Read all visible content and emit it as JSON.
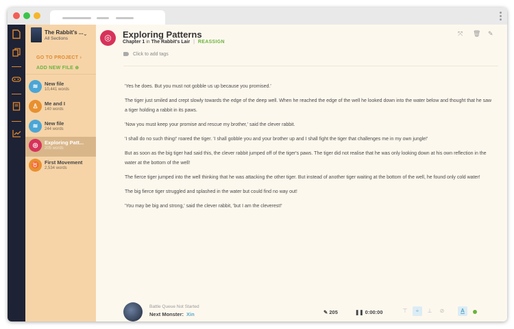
{
  "colors": {
    "accent_orange": "#e0892e",
    "accent_green": "#6bb33d",
    "rail_bg": "#1e2235",
    "sidebar_bg": "#f6d4a8",
    "active_red": "#d7325a",
    "blue": "#5aa8c8"
  },
  "rail": {
    "icons": [
      "document-icon",
      "copy-icon",
      "gamepad-icon",
      "book-icon",
      "chart-icon"
    ]
  },
  "sidebar": {
    "project": {
      "title": "The Rabbit's ...",
      "subtitle": "All Sections"
    },
    "goto_label": "GO TO PROJECT",
    "add_label": "ADD NEW FILE",
    "files": [
      {
        "name": "New file",
        "words": "10,441 words",
        "icon": "layers-icon",
        "color": "#4aa6d6"
      },
      {
        "name": "Me and I",
        "words": "140 words",
        "icon": "ribbon-icon",
        "color": "#e8902f"
      },
      {
        "name": "New file",
        "words": "244 words",
        "icon": "layers-icon",
        "color": "#4aa6d6"
      },
      {
        "name": "Exploring Patt...",
        "words": "205 words",
        "icon": "target-icon",
        "color": "#d7325a"
      },
      {
        "name": "First Movement",
        "words": "2,534 words",
        "icon": "taurus-icon",
        "color": "#e8902f"
      }
    ]
  },
  "doc": {
    "title": "Exploring Patterns",
    "chapter": "Chapter 1",
    "in": "in",
    "project": "The Rabbit's Lair",
    "reassign": "REASSIGN",
    "tags_placeholder": "Click to add tags",
    "paragraphs": [
      "'Yes he does. But you must not gobble us up because you promised.'",
      "The tiger just smiled and crept slowly towards the edge of the deep well. When he reached the edge of the well he looked down into the water below and thought that he saw a tiger holding a rabbit in its paws.",
      "'Now you must keep your promise and rescue my brother,' said the clever rabbit.",
      "'I shall do no such thing!' roared the tiger. 'I shall gobble you and your brother up and I shall fight the tiger that challenges me in my own jungle!'",
      "But as soon as the big tiger had said this, the clever rabbit jumped off of the tiger's paws. The tiger did not realise that he was only looking down at his own reflection in the water at the bottom of the well!",
      "The fierce tiger jumped into the well thinking that he was attacking the other tiger. But instead of another tiger waiting at the bottom of the well, he found only cold water!",
      "The big fierce tiger struggled and splashed in the water but could find no way out!",
      "'You may be big and strong,' said the clever rabbit, 'but I am the cleverest!'"
    ]
  },
  "footer": {
    "queue_status": "Battle Queue Not Started",
    "next_label": "Next Monster:",
    "monster_name": "Xin",
    "word_count": "205",
    "timer": "0:00:00"
  }
}
